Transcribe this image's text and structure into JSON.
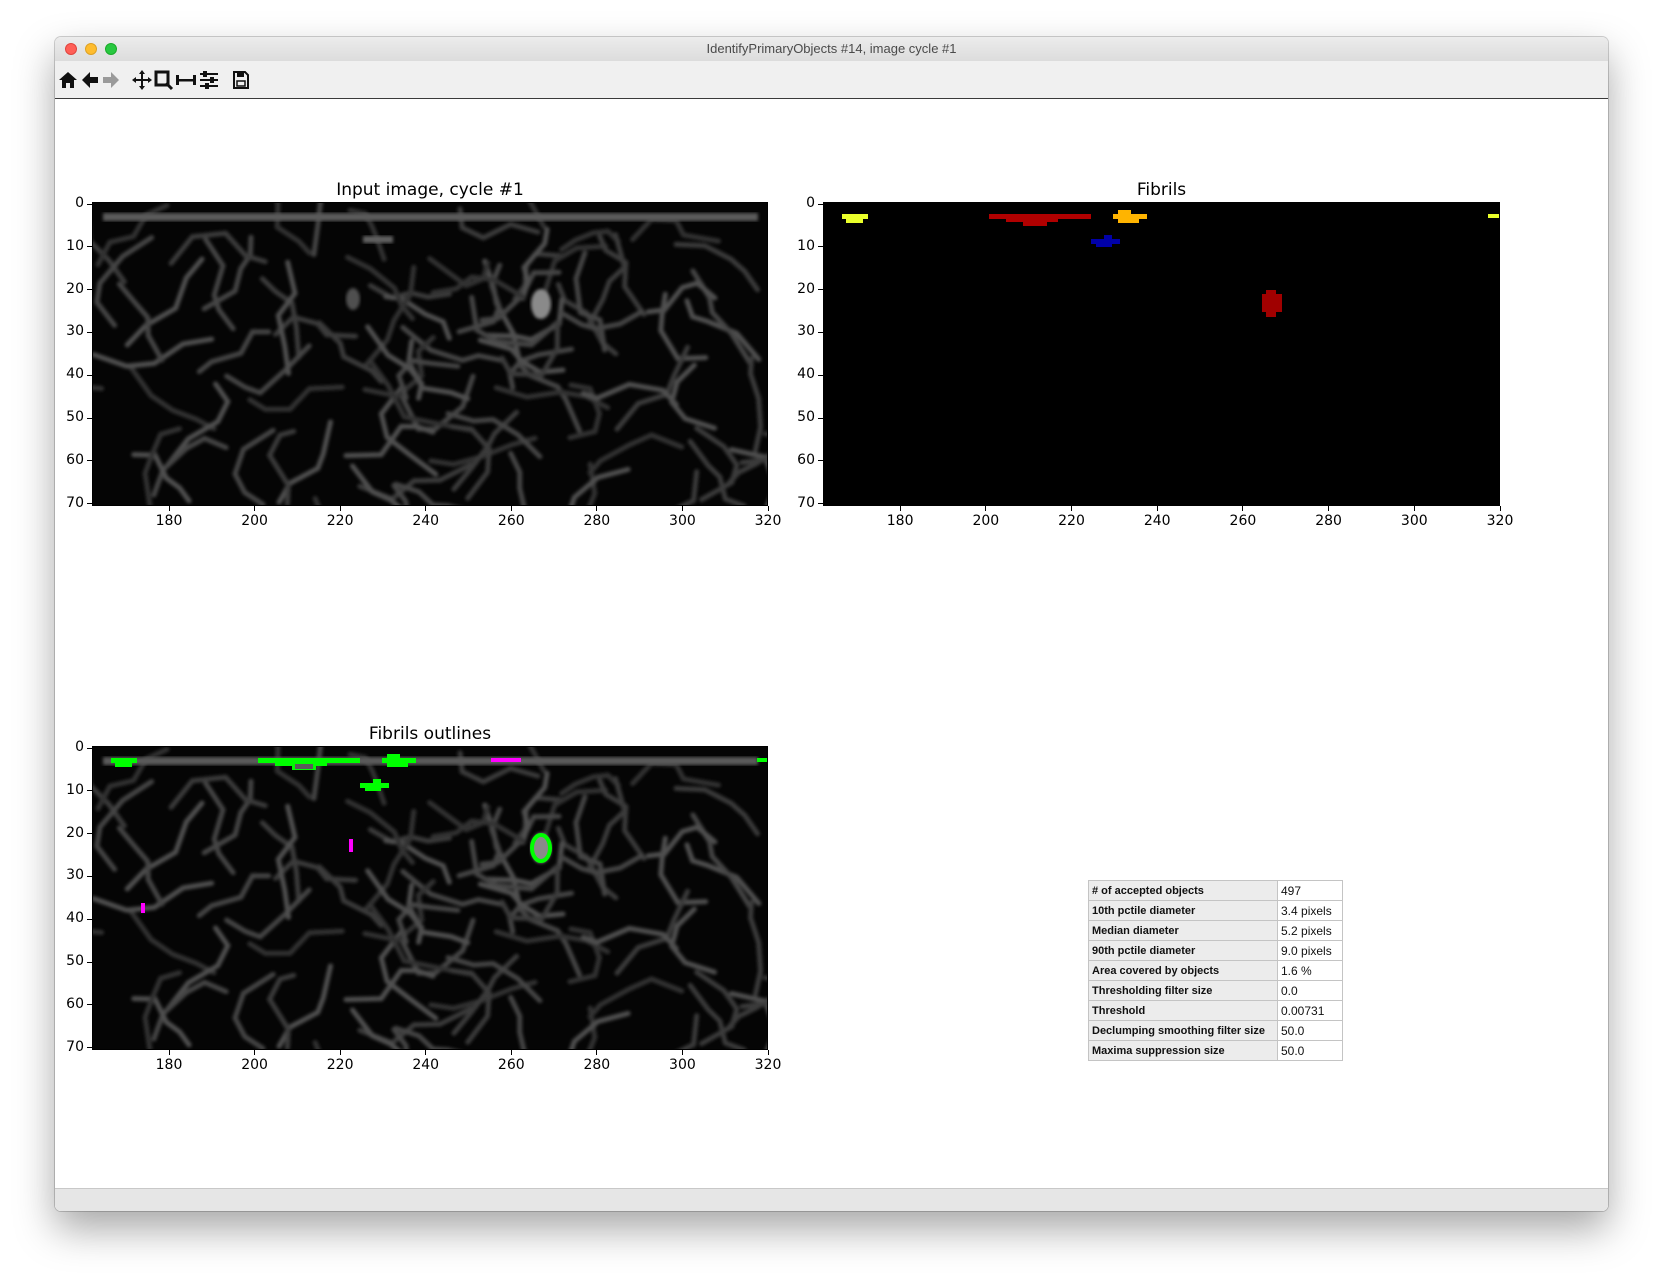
{
  "window": {
    "title": "IdentifyPrimaryObjects #14, image cycle #1"
  },
  "toolbar": {
    "tools": [
      {
        "name": "home-icon",
        "tooltip": "Home"
      },
      {
        "name": "back-icon",
        "tooltip": "Back"
      },
      {
        "name": "forward-icon",
        "tooltip": "Forward"
      },
      {
        "name": "pan-icon",
        "tooltip": "Pan"
      },
      {
        "name": "zoom-icon",
        "tooltip": "Zoom"
      },
      {
        "name": "measure-icon",
        "tooltip": "Measure"
      },
      {
        "name": "configure-icon",
        "tooltip": "Configure subplots"
      },
      {
        "name": "save-icon",
        "tooltip": "Save"
      }
    ]
  },
  "panels": [
    {
      "id": "input",
      "title": "Input image, cycle #1",
      "x_ticks": [
        "180",
        "200",
        "220",
        "240",
        "260",
        "280",
        "300",
        "320"
      ],
      "y_ticks": [
        "0",
        "10",
        "20",
        "30",
        "40",
        "50",
        "60",
        "70"
      ]
    },
    {
      "id": "fibrils",
      "title": "Fibrils",
      "x_ticks": [
        "180",
        "200",
        "220",
        "240",
        "260",
        "280",
        "300",
        "320"
      ],
      "y_ticks": [
        "0",
        "10",
        "20",
        "30",
        "40",
        "50",
        "60",
        "70"
      ]
    },
    {
      "id": "outlines",
      "title": "Fibrils outlines",
      "x_ticks": [
        "180",
        "200",
        "220",
        "240",
        "260",
        "280",
        "300",
        "320"
      ],
      "y_ticks": [
        "0",
        "10",
        "20",
        "30",
        "40",
        "50",
        "60",
        "70"
      ]
    }
  ],
  "axis": {
    "x_range": [
      162,
      320
    ],
    "y_range": [
      0,
      71
    ]
  },
  "objects": [
    {
      "label": "yellow",
      "color": "#eaff2a",
      "x": 167,
      "y": 3
    },
    {
      "label": "dark-red",
      "color": "#b00000",
      "x": 212,
      "y": 3
    },
    {
      "label": "orange",
      "color": "#ffb400",
      "x": 233,
      "y": 3
    },
    {
      "label": "blue",
      "color": "#0000a8",
      "x": 229,
      "y": 9
    },
    {
      "label": "dark-red-2",
      "color": "#a00000",
      "x": 267,
      "y": 24
    },
    {
      "label": "yellow-2",
      "color": "#eaff2a",
      "x": 319,
      "y": 3
    }
  ],
  "stats": [
    {
      "key": "# of accepted objects",
      "value": "497"
    },
    {
      "key": "10th pctile diameter",
      "value": "3.4 pixels"
    },
    {
      "key": "Median diameter",
      "value": "5.2 pixels"
    },
    {
      "key": "90th pctile diameter",
      "value": "9.0 pixels"
    },
    {
      "key": "Area covered by objects",
      "value": "1.6 %"
    },
    {
      "key": "Thresholding filter size",
      "value": "0.0"
    },
    {
      "key": "Threshold",
      "value": "0.00731"
    },
    {
      "key": "Declumping smoothing filter size",
      "value": "50.0"
    },
    {
      "key": "Maxima suppression size",
      "value": "50.0"
    }
  ]
}
